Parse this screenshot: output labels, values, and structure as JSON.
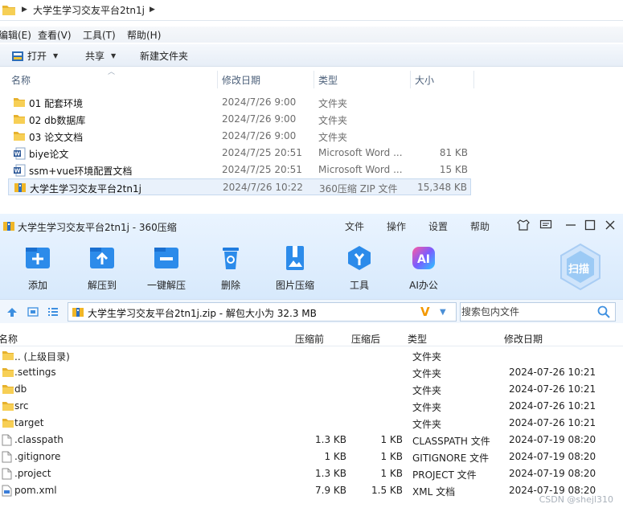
{
  "explorer": {
    "path": "大学生学习交友平台2tn1j",
    "menu": [
      "编辑(E)",
      "查看(V)",
      "工具(T)",
      "帮助(H)"
    ],
    "toolbar": {
      "open": "打开",
      "share": "共享",
      "new_folder": "新建文件夹"
    },
    "columns": {
      "name": "名称",
      "date": "修改日期",
      "type": "类型",
      "size": "大小"
    },
    "rows": [
      {
        "name": "01 配套环境",
        "date": "2024/7/26 9:00",
        "type": "文件夹",
        "size": "",
        "icon": "folder-icon"
      },
      {
        "name": "02 db数据库",
        "date": "2024/7/26 9:00",
        "type": "文件夹",
        "size": "",
        "icon": "folder-icon"
      },
      {
        "name": "03 论文文档",
        "date": "2024/7/26 9:00",
        "type": "文件夹",
        "size": "",
        "icon": "folder-icon"
      },
      {
        "name": "biye论文",
        "date": "2024/7/25 20:51",
        "type": "Microsoft Word ...",
        "size": "81 KB",
        "icon": "word-doc-icon"
      },
      {
        "name": "ssm+vue环境配置文档",
        "date": "2024/7/25 20:51",
        "type": "Microsoft Word ...",
        "size": "15 KB",
        "icon": "word-doc-icon"
      },
      {
        "name": "大学生学习交友平台2tn1j",
        "date": "2024/7/26 10:22",
        "type": "360压缩 ZIP 文件",
        "size": "15,348 KB",
        "icon": "zip-archive-icon"
      }
    ]
  },
  "zip": {
    "title": "大学生学习交友平台2tn1j - 360压缩",
    "menu": [
      "文件",
      "操作",
      "设置",
      "帮助"
    ],
    "tools": [
      "添加",
      "解压到",
      "一键解压",
      "删除",
      "图片压缩",
      "工具",
      "AI办公"
    ],
    "scan_label": "扫描",
    "path_text": "大学生学习交友平台2tn1j.zip - 解包大小为 32.3 MB",
    "search_placeholder": "搜索包内文件",
    "columns": {
      "name": "名称",
      "before": "压缩前",
      "after": "压缩后",
      "type": "类型",
      "date": "修改日期"
    },
    "rows": [
      {
        "name": ".. (上级目录)",
        "before": "",
        "after": "",
        "type": "文件夹",
        "date": "",
        "icon": "folder-icon"
      },
      {
        "name": ".settings",
        "before": "",
        "after": "",
        "type": "文件夹",
        "date": "2024-07-26 10:21",
        "icon": "folder-icon"
      },
      {
        "name": "db",
        "before": "",
        "after": "",
        "type": "文件夹",
        "date": "2024-07-26 10:21",
        "icon": "folder-icon"
      },
      {
        "name": "src",
        "before": "",
        "after": "",
        "type": "文件夹",
        "date": "2024-07-26 10:21",
        "icon": "folder-icon"
      },
      {
        "name": "target",
        "before": "",
        "after": "",
        "type": "文件夹",
        "date": "2024-07-26 10:21",
        "icon": "folder-icon"
      },
      {
        "name": ".classpath",
        "before": "1.3 KB",
        "after": "1 KB",
        "type": "CLASSPATH 文件",
        "date": "2024-07-19 08:20",
        "icon": "file-icon"
      },
      {
        "name": ".gitignore",
        "before": "1 KB",
        "after": "1 KB",
        "type": "GITIGNORE 文件",
        "date": "2024-07-19 08:20",
        "icon": "file-icon"
      },
      {
        "name": ".project",
        "before": "1.3 KB",
        "after": "1 KB",
        "type": "PROJECT 文件",
        "date": "2024-07-19 08:20",
        "icon": "file-icon"
      },
      {
        "name": "pom.xml",
        "before": "7.9 KB",
        "after": "1.5 KB",
        "type": "XML 文档",
        "date": "2024-07-19 08:20",
        "icon": "xml-file-icon"
      }
    ],
    "watermark": "CSDN @shejl310"
  }
}
